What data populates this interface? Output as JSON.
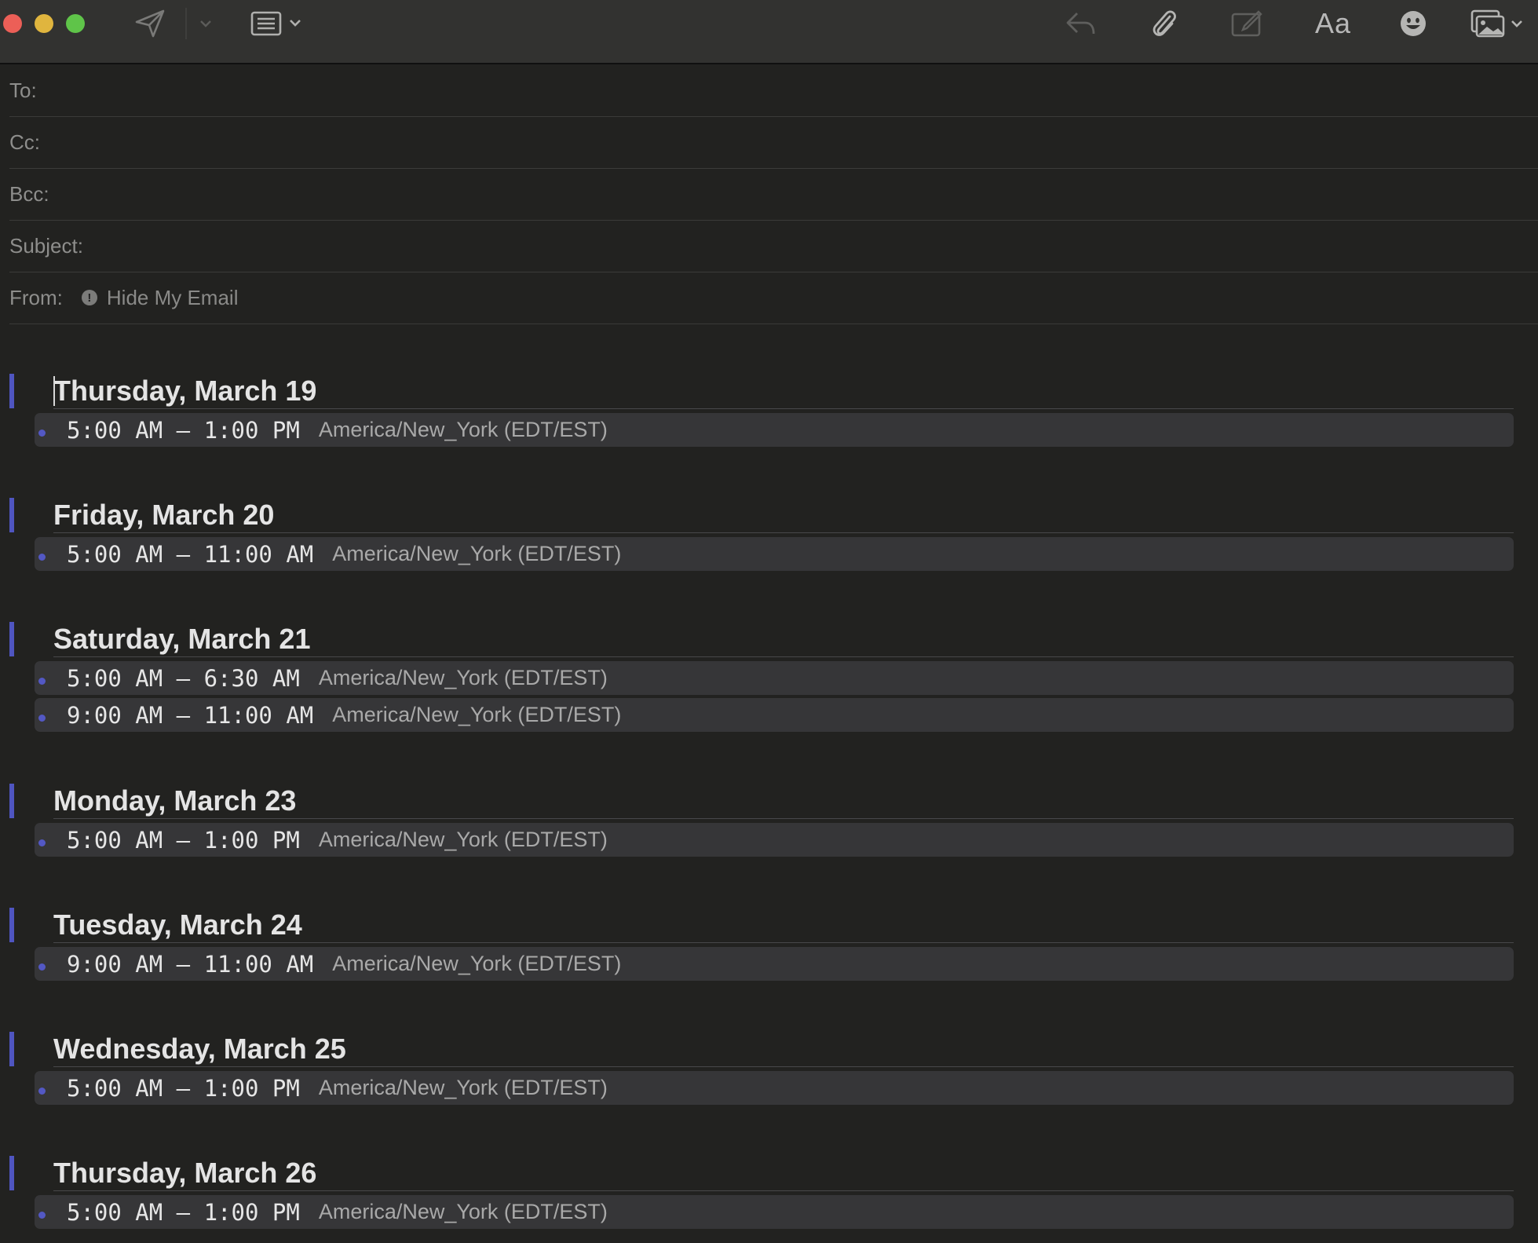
{
  "toolbar": {
    "icons": [
      "send-icon",
      "send-options-chevron-icon",
      "header-fields-icon",
      "reply-icon",
      "attachment-icon",
      "markup-icon",
      "format-icon",
      "emoji-icon",
      "photo-browser-icon"
    ],
    "format_label": "Aa"
  },
  "header": {
    "to_label": "To:",
    "cc_label": "Cc:",
    "bcc_label": "Bcc:",
    "subject_label": "Subject:",
    "from_label": "From:",
    "from_value": "Hide My Email"
  },
  "colors": {
    "accent": "#4f55c0",
    "background": "#222220",
    "slot_background": "#363638"
  },
  "days": [
    {
      "title": "Thursday, March 19",
      "slots": [
        {
          "time": "5:00 AM – 1:00 PM",
          "tz": "America/New_York (EDT/EST)"
        }
      ]
    },
    {
      "title": "Friday, March 20",
      "slots": [
        {
          "time": "5:00 AM – 11:00 AM",
          "tz": "America/New_York (EDT/EST)"
        }
      ]
    },
    {
      "title": "Saturday, March 21",
      "slots": [
        {
          "time": "5:00 AM – 6:30 AM",
          "tz": "America/New_York (EDT/EST)"
        },
        {
          "time": "9:00 AM – 11:00 AM",
          "tz": "America/New_York (EDT/EST)"
        }
      ]
    },
    {
      "title": "Monday, March 23",
      "slots": [
        {
          "time": "5:00 AM – 1:00 PM",
          "tz": "America/New_York (EDT/EST)"
        }
      ]
    },
    {
      "title": "Tuesday, March 24",
      "slots": [
        {
          "time": "9:00 AM – 11:00 AM",
          "tz": "America/New_York (EDT/EST)"
        }
      ]
    },
    {
      "title": "Wednesday, March 25",
      "slots": [
        {
          "time": "5:00 AM – 1:00 PM",
          "tz": "America/New_York (EDT/EST)"
        }
      ]
    },
    {
      "title": "Thursday, March 26",
      "slots": [
        {
          "time": "5:00 AM – 1:00 PM",
          "tz": "America/New_York (EDT/EST)"
        }
      ]
    }
  ]
}
